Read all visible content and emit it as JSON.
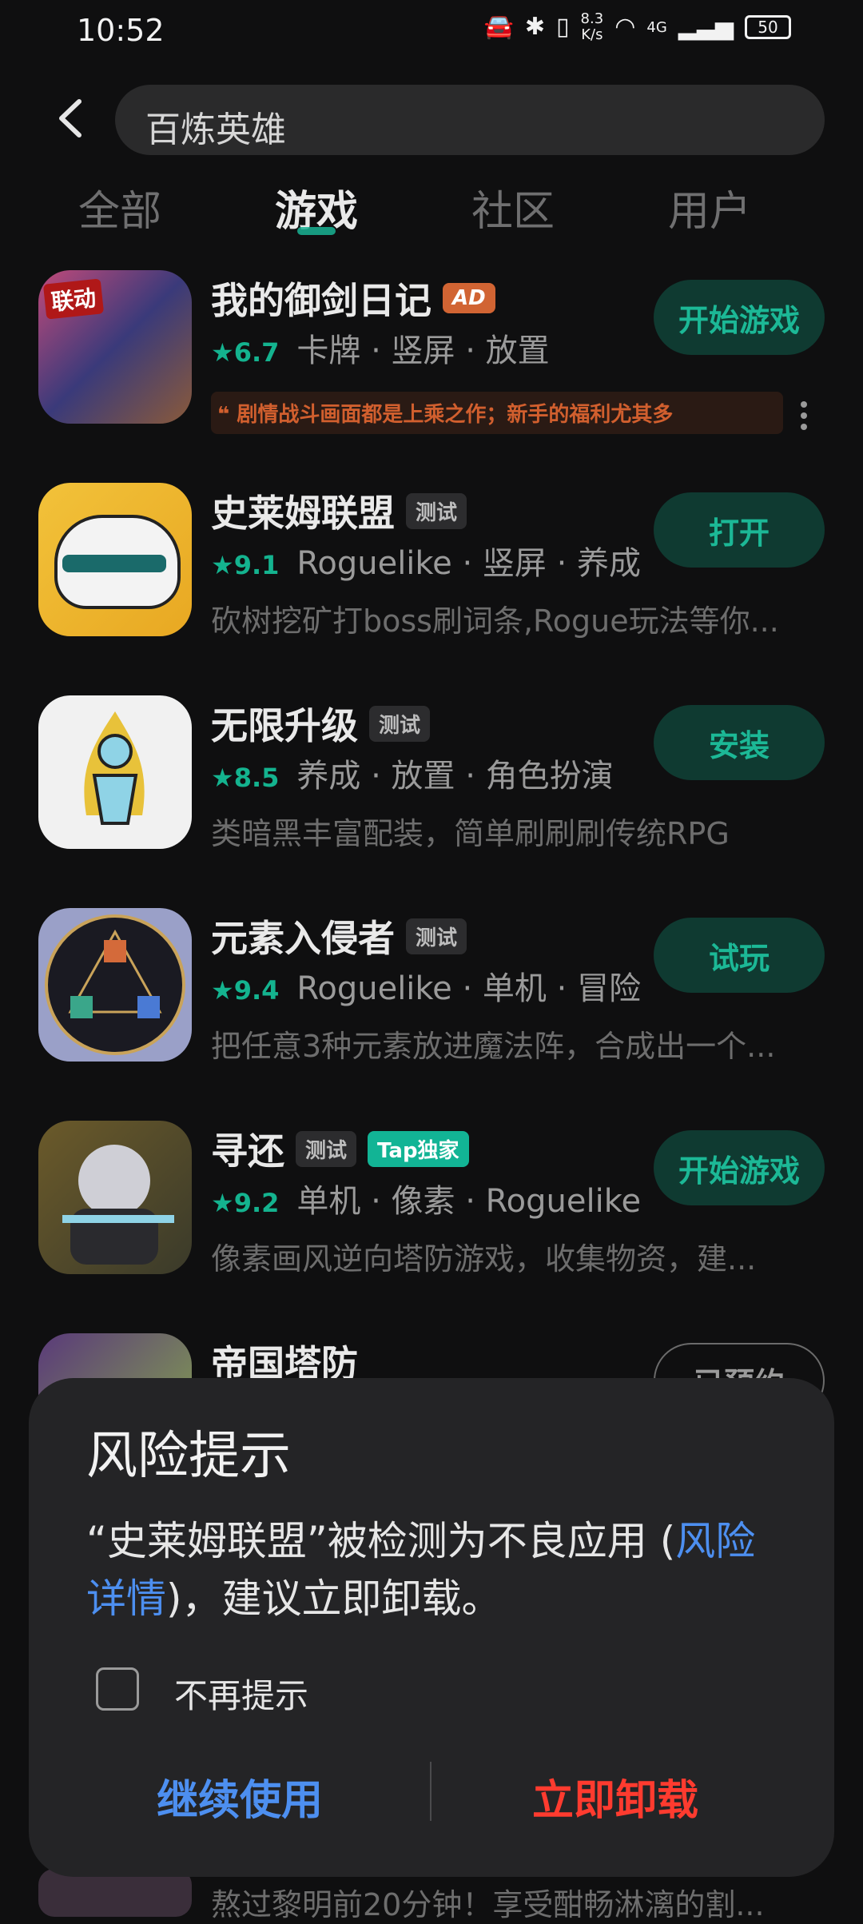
{
  "status": {
    "time": "10:52",
    "net_speed_value": "8.3",
    "net_speed_unit": "K/s",
    "signal_label": "4G",
    "battery": "50"
  },
  "search": {
    "query": "百炼英雄"
  },
  "tabs": [
    {
      "label": "全部",
      "active": false
    },
    {
      "label": "游戏",
      "active": true
    },
    {
      "label": "社区",
      "active": false
    },
    {
      "label": "用户",
      "active": false
    }
  ],
  "apps": [
    {
      "title": "我的御剑日记",
      "badge": "AD",
      "rating": "★6.7",
      "tags": "卡牌 · 竖屏 · 放置",
      "desc": "剧情战斗画面都是上乘之作；新手的福利尤其多",
      "action": "开始游戏",
      "icon_text": "联动"
    },
    {
      "title": "史莱姆联盟",
      "badge": "测试",
      "rating": "★9.1",
      "tags": "Roguelike · 竖屏 · 养成",
      "desc": "砍树挖矿打boss刷词条,Rogue玩法等你...",
      "action": "打开"
    },
    {
      "title": "无限升级",
      "badge": "测试",
      "rating": "★8.5",
      "tags": "养成 · 放置 · 角色扮演",
      "desc": "类暗黑丰富配装，简单刷刷刷传统RPG",
      "action": "安装"
    },
    {
      "title": "元素入侵者",
      "badge": "测试",
      "rating": "★9.4",
      "tags": "Roguelike · 单机 · 冒险",
      "desc": "把任意3种元素放进魔法阵，合成出一个...",
      "action": "试玩"
    },
    {
      "title": "寻还",
      "badge": "测试",
      "badge2": "Tap独家",
      "rating": "★9.2",
      "tags": "单机 · 像素 · Roguelike",
      "desc": "像素画风逆向塔防游戏，收集物资，建...",
      "action": "开始游戏"
    },
    {
      "title": "帝国塔防",
      "action": "已预约"
    }
  ],
  "bottom_desc": "熬过黎明前20分钟！享受酣畅淋漓的割...",
  "dialog": {
    "title": "风险提示",
    "body_prefix": "“史莱姆联盟”被检测为不良应用 (",
    "link": "风险详情",
    "body_suffix": ")，建议立即卸载。",
    "checkbox_label": "不再提示",
    "btn_continue": "继续使用",
    "btn_uninstall": "立即卸载"
  }
}
